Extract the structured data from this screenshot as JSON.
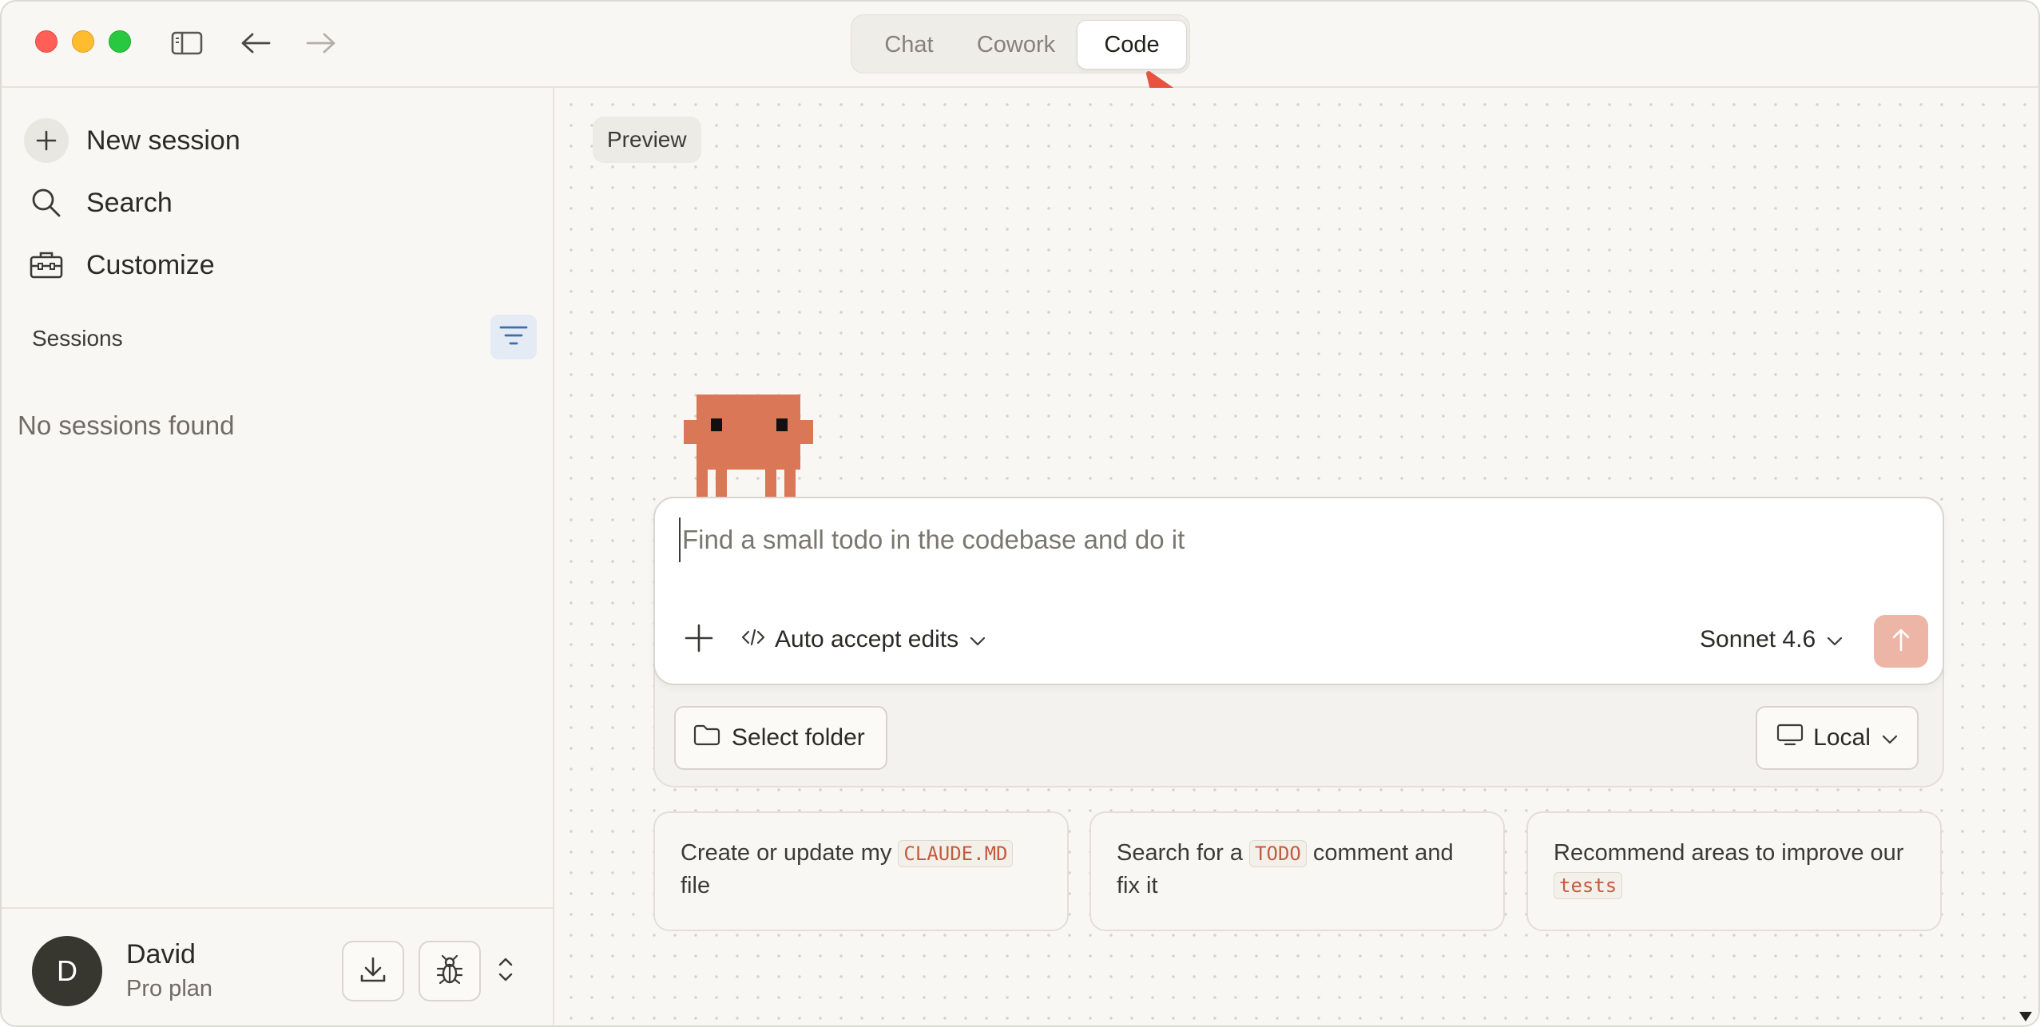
{
  "titlebar": {
    "modes": [
      {
        "label": "Chat",
        "active": false
      },
      {
        "label": "Cowork",
        "active": false
      },
      {
        "label": "Code",
        "active": true
      }
    ]
  },
  "sidebar": {
    "items": [
      {
        "label": "New session",
        "icon": "plus-icon"
      },
      {
        "label": "Search",
        "icon": "search-icon"
      },
      {
        "label": "Customize",
        "icon": "toolbox-icon"
      }
    ],
    "sessions_label": "Sessions",
    "empty_text": "No sessions found"
  },
  "user": {
    "initial": "D",
    "name": "David",
    "plan": "Pro plan"
  },
  "main": {
    "preview_label": "Preview",
    "composer": {
      "placeholder": "Find a small todo in the codebase and do it",
      "mode_label": "Auto accept edits",
      "model_label": "Sonnet 4.6"
    },
    "folder_label": "Select folder",
    "env_label": "Local",
    "suggestions": [
      {
        "before": "Create or update my",
        "code": "CLAUDE.MD",
        "after": "file"
      },
      {
        "before": "Search for a",
        "code": "TODO",
        "after": "comment and fix it"
      },
      {
        "before": "Recommend areas to improve our",
        "code": "tests",
        "after": ""
      }
    ]
  },
  "colors": {
    "accent": "#d97757",
    "send_disabled": "#ecb5a5",
    "arrow": "#e8533f",
    "background": "#f8f7f4"
  }
}
